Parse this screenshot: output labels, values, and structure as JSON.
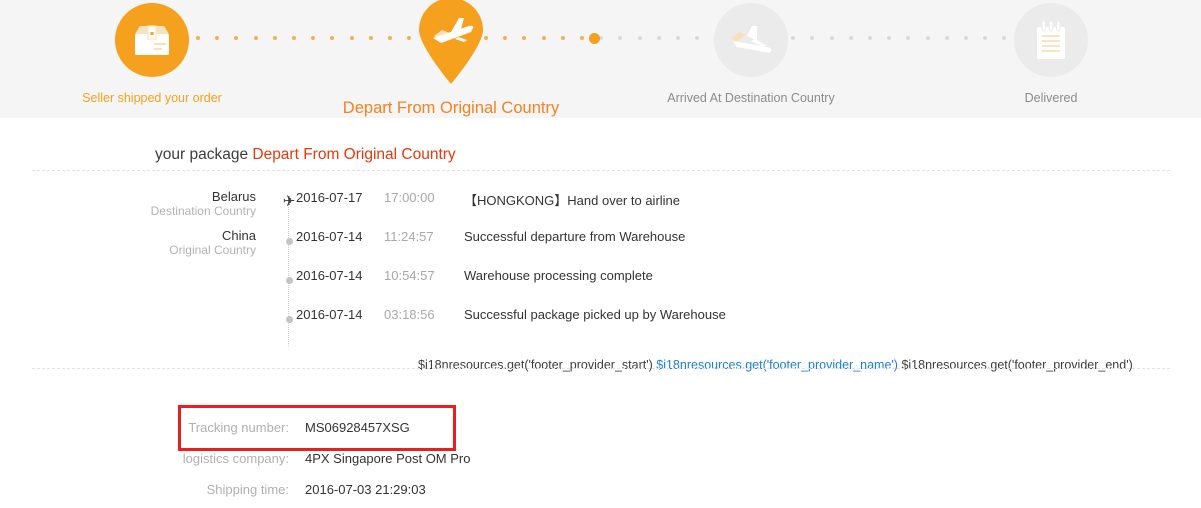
{
  "colors": {
    "brand_orange": "#f5a11d",
    "current_orange": "#f5821f",
    "status_red": "#e8380d",
    "highlight_red": "#ee1c1c",
    "link_blue": "#1b7fd4",
    "header_bg": "#f5f5f5"
  },
  "progress": {
    "steps": [
      {
        "label": "Seller shipped your order",
        "icon": "package-box-icon",
        "state": "done"
      },
      {
        "label": "Depart From Original Country",
        "icon": "departing-plane-pin-icon",
        "state": "current"
      },
      {
        "label": "Arrived At Destination Country",
        "icon": "landing-plane-icon",
        "state": "todo"
      },
      {
        "label": "Delivered",
        "icon": "notepad-icon",
        "state": "todo"
      }
    ]
  },
  "headline": {
    "prefix": "your package ",
    "status": "Depart From Original Country"
  },
  "timeline": {
    "countries": {
      "destination_name": "Belarus",
      "destination_sub": "Destination Country",
      "origin_name": "China",
      "origin_sub": "Original Country"
    },
    "events": [
      {
        "date": "2016-07-17",
        "time": "17:00:00",
        "desc": "【HONGKONG】Hand over to airline",
        "marker": "plane-icon"
      },
      {
        "date": "2016-07-14",
        "time": "11:24:57",
        "desc": "Successful departure from Warehouse",
        "marker": "dot-icon"
      },
      {
        "date": "2016-07-14",
        "time": "10:54:57",
        "desc": "Warehouse processing complete",
        "marker": "dot-icon"
      },
      {
        "date": "2016-07-14",
        "time": "03:18:56",
        "desc": "Successful package picked up by Warehouse",
        "marker": "dot-icon"
      }
    ],
    "footer_note": {
      "start": "$i18nresources.get('footer_provider_start')",
      "link": "$i18nresources.get('footer_provider_name')",
      "end": "$i18nresources.get('footer_provider_end')"
    }
  },
  "details": [
    {
      "label": "Tracking number:",
      "value": "MS06928457XSG"
    },
    {
      "label": "logistics company:",
      "value": "4PX Singapore Post OM Pro"
    },
    {
      "label": "Shipping time:",
      "value": "2016-07-03 21:29:03"
    }
  ]
}
